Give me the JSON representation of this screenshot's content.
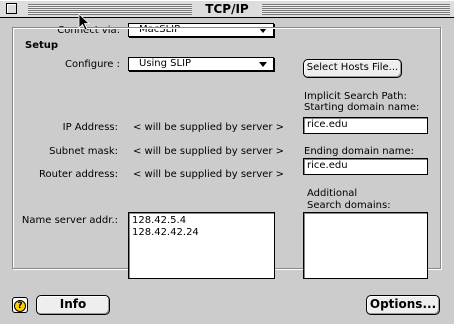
{
  "window": {
    "title": "TCP/IP"
  },
  "connect": {
    "label": "Connect via:",
    "value": "MacSLIP"
  },
  "setup": {
    "group_label": "Setup",
    "configure_label": "Configure :",
    "configure_value": "Using SLIP",
    "select_hosts_button": "Select Hosts File...",
    "ip_label": "IP Address:",
    "ip_value": "< will be supplied by server >",
    "subnet_label": "Subnet mask:",
    "subnet_value": "< will be supplied by server >",
    "router_label": "Router address:",
    "router_value": "< will be supplied by server >",
    "name_server_label": "Name server addr.:",
    "name_servers": [
      "128.42.5.4",
      "128.42.42.24"
    ],
    "implicit_search_label": "Implicit Search Path:",
    "starting_domain_label": "Starting domain name:",
    "starting_domain_value": "rice.edu",
    "ending_domain_label": "Ending domain name:",
    "ending_domain_value": "rice.edu",
    "additional_label_1": "Additional",
    "additional_label_2": "Search domains:",
    "additional_domains": []
  },
  "footer": {
    "info_button": "Info",
    "options_button": "Options...",
    "help_icon_glyph": "?"
  }
}
